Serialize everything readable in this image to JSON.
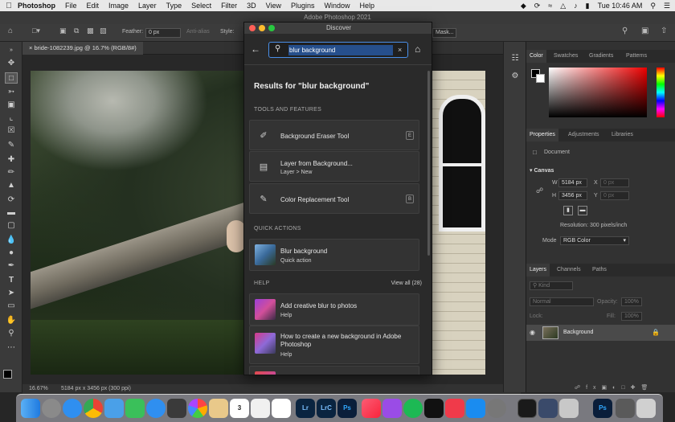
{
  "menubar": {
    "apple": "",
    "app": "Photoshop",
    "items": [
      "File",
      "Edit",
      "Image",
      "Layer",
      "Type",
      "Select",
      "Filter",
      "3D",
      "View",
      "Plugins",
      "Window",
      "Help"
    ],
    "clock": "Tue 10:46 AM"
  },
  "window_title": "Adobe Photoshop 2021",
  "options": {
    "feather_label": "Feather:",
    "feather_value": "0 px",
    "antialias": "Anti-alias",
    "style_label": "Style:",
    "mask_button": "Mask..."
  },
  "document": {
    "tab": "bride-1082239.jpg @ 16.7% (RGB/8#)",
    "zoom": "16.67%",
    "info": "5184 px x 3456 px (300 ppi)"
  },
  "discover": {
    "title": "Discover",
    "search_value": "blur background",
    "results_heading": "Results for \"blur background\"",
    "sections": {
      "tools": "TOOLS AND FEATURES",
      "quick": "QUICK ACTIONS",
      "help": "HELP",
      "view_all": "View all (28)"
    },
    "tools": [
      {
        "label": "Background Eraser Tool",
        "sub": "",
        "key": "E"
      },
      {
        "label": "Layer from Background...",
        "sub": "Layer > New",
        "key": ""
      },
      {
        "label": "Color Replacement Tool",
        "sub": "",
        "key": "B"
      }
    ],
    "quick_action": {
      "label": "Blur background",
      "sub": "Quick action"
    },
    "help": [
      {
        "label": "Add creative blur to photos",
        "sub": "Help"
      },
      {
        "label": "How to create a new background in Adobe Photoshop",
        "sub": "Help"
      }
    ]
  },
  "panels": {
    "color_tabs": [
      "Color",
      "Swatches",
      "Gradients",
      "Patterns"
    ],
    "props_tabs": [
      "Properties",
      "Adjustments",
      "Libraries"
    ],
    "document_label": "Document",
    "canvas_label": "Canvas",
    "w_label": "W",
    "w_value": "5184 px",
    "h_label": "H",
    "h_value": "3456 px",
    "x_label": "X",
    "x_value": "0 px",
    "y_label": "Y",
    "y_value": "0 px",
    "resolution": "Resolution: 300 pixels/inch",
    "mode_label": "Mode",
    "mode_value": "RGB Color",
    "layers_tabs": [
      "Layers",
      "Channels",
      "Paths"
    ],
    "kind": "Kind",
    "blend": "Normal",
    "opacity_label": "Opacity:",
    "opacity_value": "100%",
    "lock_label": "Lock:",
    "fill_label": "Fill:",
    "fill_value": "100%",
    "layer_name": "Background"
  },
  "dock_labels": {
    "lr": "Lr",
    "lrc": "LrC",
    "ps": "Ps",
    "psd": "Ps",
    "calendar": "3"
  },
  "colors": {
    "accent": "#4a8fe8",
    "panel_bg": "#323232",
    "modal_bg": "#2a2a2a"
  }
}
